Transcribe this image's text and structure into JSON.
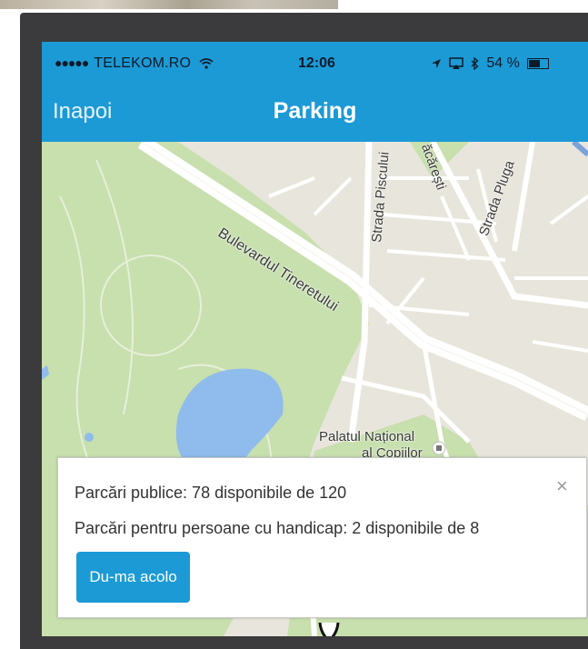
{
  "status_bar": {
    "signal_dots": "●●●●●",
    "carrier": "TELEKOM.RO",
    "wifi_icon": "wifi-icon",
    "time": "12:06",
    "location_icon": "location-arrow-icon",
    "screen_mirror_icon": "airplay-icon",
    "bluetooth_icon": "bluetooth-icon",
    "battery": "54 %"
  },
  "nav_bar": {
    "back_label": "Inapoi",
    "title": "Parking"
  },
  "map": {
    "labels": {
      "bulevard": "Bulevardul Tineretului",
      "strada_piscului": "Strada Piscului",
      "strada_pluga": "Strada Pluga",
      "vacaresti": "ăcărești",
      "palatul_line1": "Palatul Național",
      "palatul_line2": "al Copiilor"
    },
    "colors": {
      "park": "#c8dfae",
      "water": "#8fbcec",
      "land": "#e8e5dc",
      "road": "#ffffff"
    }
  },
  "info_card": {
    "public_parking": "Parcări publice: 78 disponibile de 120",
    "handicap_parking": "Parcări pentru persoane cu handicap: 2 disponibile de 8",
    "close_symbol": "×",
    "go_button": "Du-ma acolo"
  },
  "accent_color": "#1c9ad6"
}
